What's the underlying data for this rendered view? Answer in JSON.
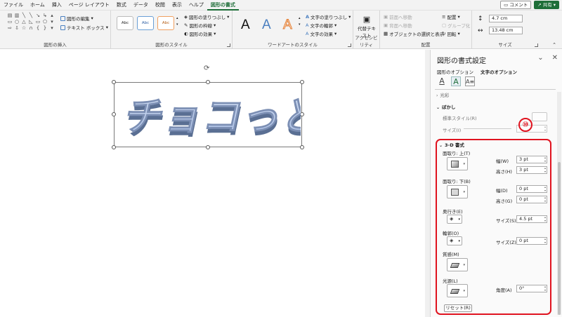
{
  "tabs": [
    "ファイル",
    "ホーム",
    "挿入",
    "ページ レイアウト",
    "数式",
    "データ",
    "校閲",
    "表示",
    "ヘルプ",
    "図形の書式"
  ],
  "active_tab": "図形の書式",
  "top_right": {
    "comment": "コメント",
    "share": "共有"
  },
  "ribbon": {
    "insert_shapes": {
      "label": "図形の挿入",
      "edit_shape": "図形の編集",
      "text_box": "テキスト ボックス"
    },
    "shape_styles": {
      "label": "図形のスタイル",
      "style_sample": "Abc",
      "fill": "図形の塗りつぶし",
      "outline": "図形の枠線",
      "effects": "図形の効果"
    },
    "wordart_styles": {
      "label": "ワードアートのスタイル",
      "letter": "A",
      "text_fill": "文字の塗りつぶし",
      "text_outline": "文字の輪郭",
      "text_effects": "文字の効果"
    },
    "accessibility": {
      "label": "アクセシビリティ",
      "alt_text": "代替テキスト"
    },
    "arrange": {
      "label": "配置",
      "bring_forward": "前面へ移動",
      "send_backward": "背面へ移動",
      "selection_pane": "オブジェクトの選択と表示",
      "align": "配置",
      "group": "グループ化",
      "rotate": "回転"
    },
    "size": {
      "label": "サイズ",
      "height": "4.7 cm",
      "width": "13.48 cm"
    }
  },
  "document": {
    "wordart_text": "チョコっと"
  },
  "pane": {
    "title": "図形の書式設定",
    "tabs": [
      "図形のオプション",
      "文字のオプション"
    ],
    "sections": {
      "shadow_partial": "光彩",
      "blur": "ぼかし",
      "three_d": "3-D 書式"
    },
    "blur": {
      "preset_label": "標準スタイル(R)",
      "size_label": "サイズ(I)"
    },
    "three_d": {
      "top_bevel": "面取り: 上(T)",
      "bottom_bevel": "面取り: 下(B)",
      "width_label": "幅(W)",
      "height_label": "高さ(H)",
      "width_d_label": "幅(D)",
      "height_g_label": "高さ(G)",
      "top_width": "3 pt",
      "top_height": "3 pt",
      "bottom_width": "0 pt",
      "bottom_height": "0 pt",
      "depth": "奥行き(E)",
      "depth_size_label": "サイズ(S)",
      "depth_size": "4.5 pt",
      "contour": "輪郭(O)",
      "contour_size_label": "サイズ(Z)",
      "contour_size": "0 pt",
      "material": "質感(M)",
      "lighting": "光源(L)",
      "angle_label": "角度(A)",
      "angle": "0°",
      "reset": "リセット(R)"
    }
  },
  "annotation": {
    "number": "⑩"
  },
  "colors": {
    "accent": "#1e6e38",
    "wordart_fill": "#b4c6e7",
    "highlight": "#e0131f"
  }
}
